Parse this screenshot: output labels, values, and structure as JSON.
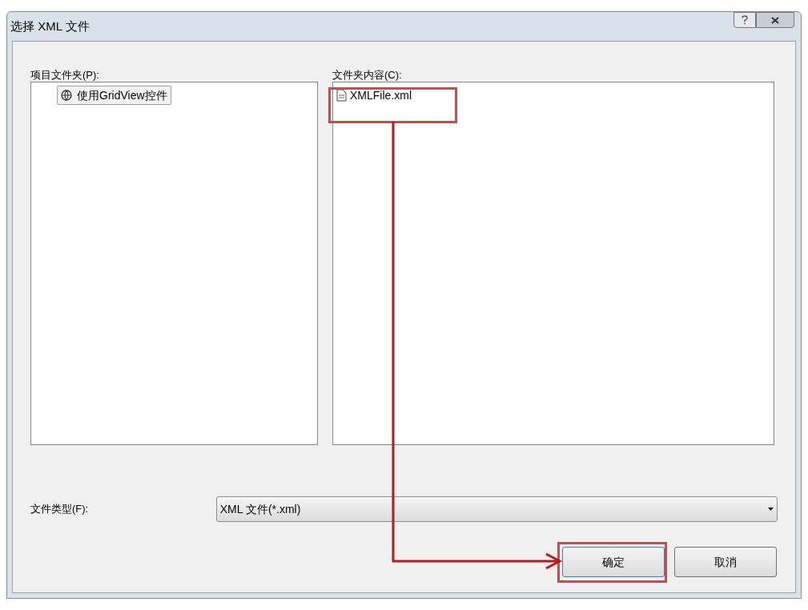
{
  "window": {
    "title": "选择 XML 文件"
  },
  "project_folders": {
    "label": "项目文件夹(P):",
    "items": [
      {
        "label": "使用GridView控件",
        "selected": true
      }
    ]
  },
  "folder_contents": {
    "label": "文件夹内容(C):",
    "items": [
      {
        "name": "XMLFile.xml",
        "selected": false
      }
    ]
  },
  "file_type": {
    "label": "文件类型(F):",
    "value": "XML 文件(*.xml)"
  },
  "buttons": [
    {
      "label": "确定",
      "kind": "ok"
    },
    {
      "label": "取消",
      "kind": "cancel"
    }
  ]
}
